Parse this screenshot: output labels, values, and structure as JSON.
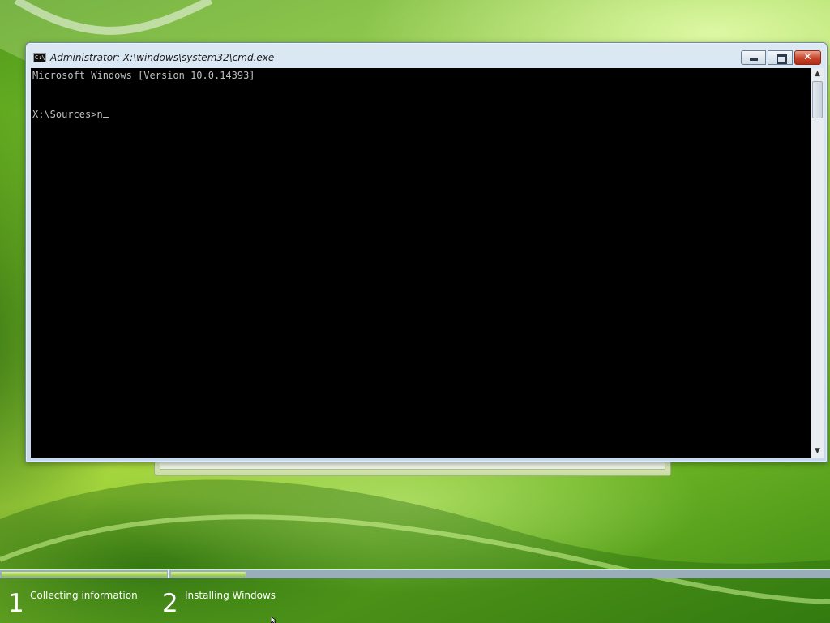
{
  "window": {
    "title": "Administrator: X:\\windows\\system32\\cmd.exe",
    "icon": "cmd-icon",
    "icon_glyph": "C:\\",
    "controls": {
      "close_glyph": "✕"
    }
  },
  "console": {
    "lines": [
      "Microsoft Windows [Version 10.0.14393]",
      "X:\\Sources>n"
    ]
  },
  "scrollbar": {
    "up_glyph": "▲",
    "down_glyph": "▼"
  },
  "progress": {
    "steps": [
      {
        "number": "1",
        "label": "Collecting information",
        "fill": 1.0
      },
      {
        "number": "2",
        "label": "Installing Windows",
        "fill": 0.11
      }
    ]
  },
  "colors": {
    "console_bg": "#000000",
    "console_text": "#c0c0c0",
    "progress_fill": "#8cc33a",
    "close_button": "#c7432a"
  }
}
